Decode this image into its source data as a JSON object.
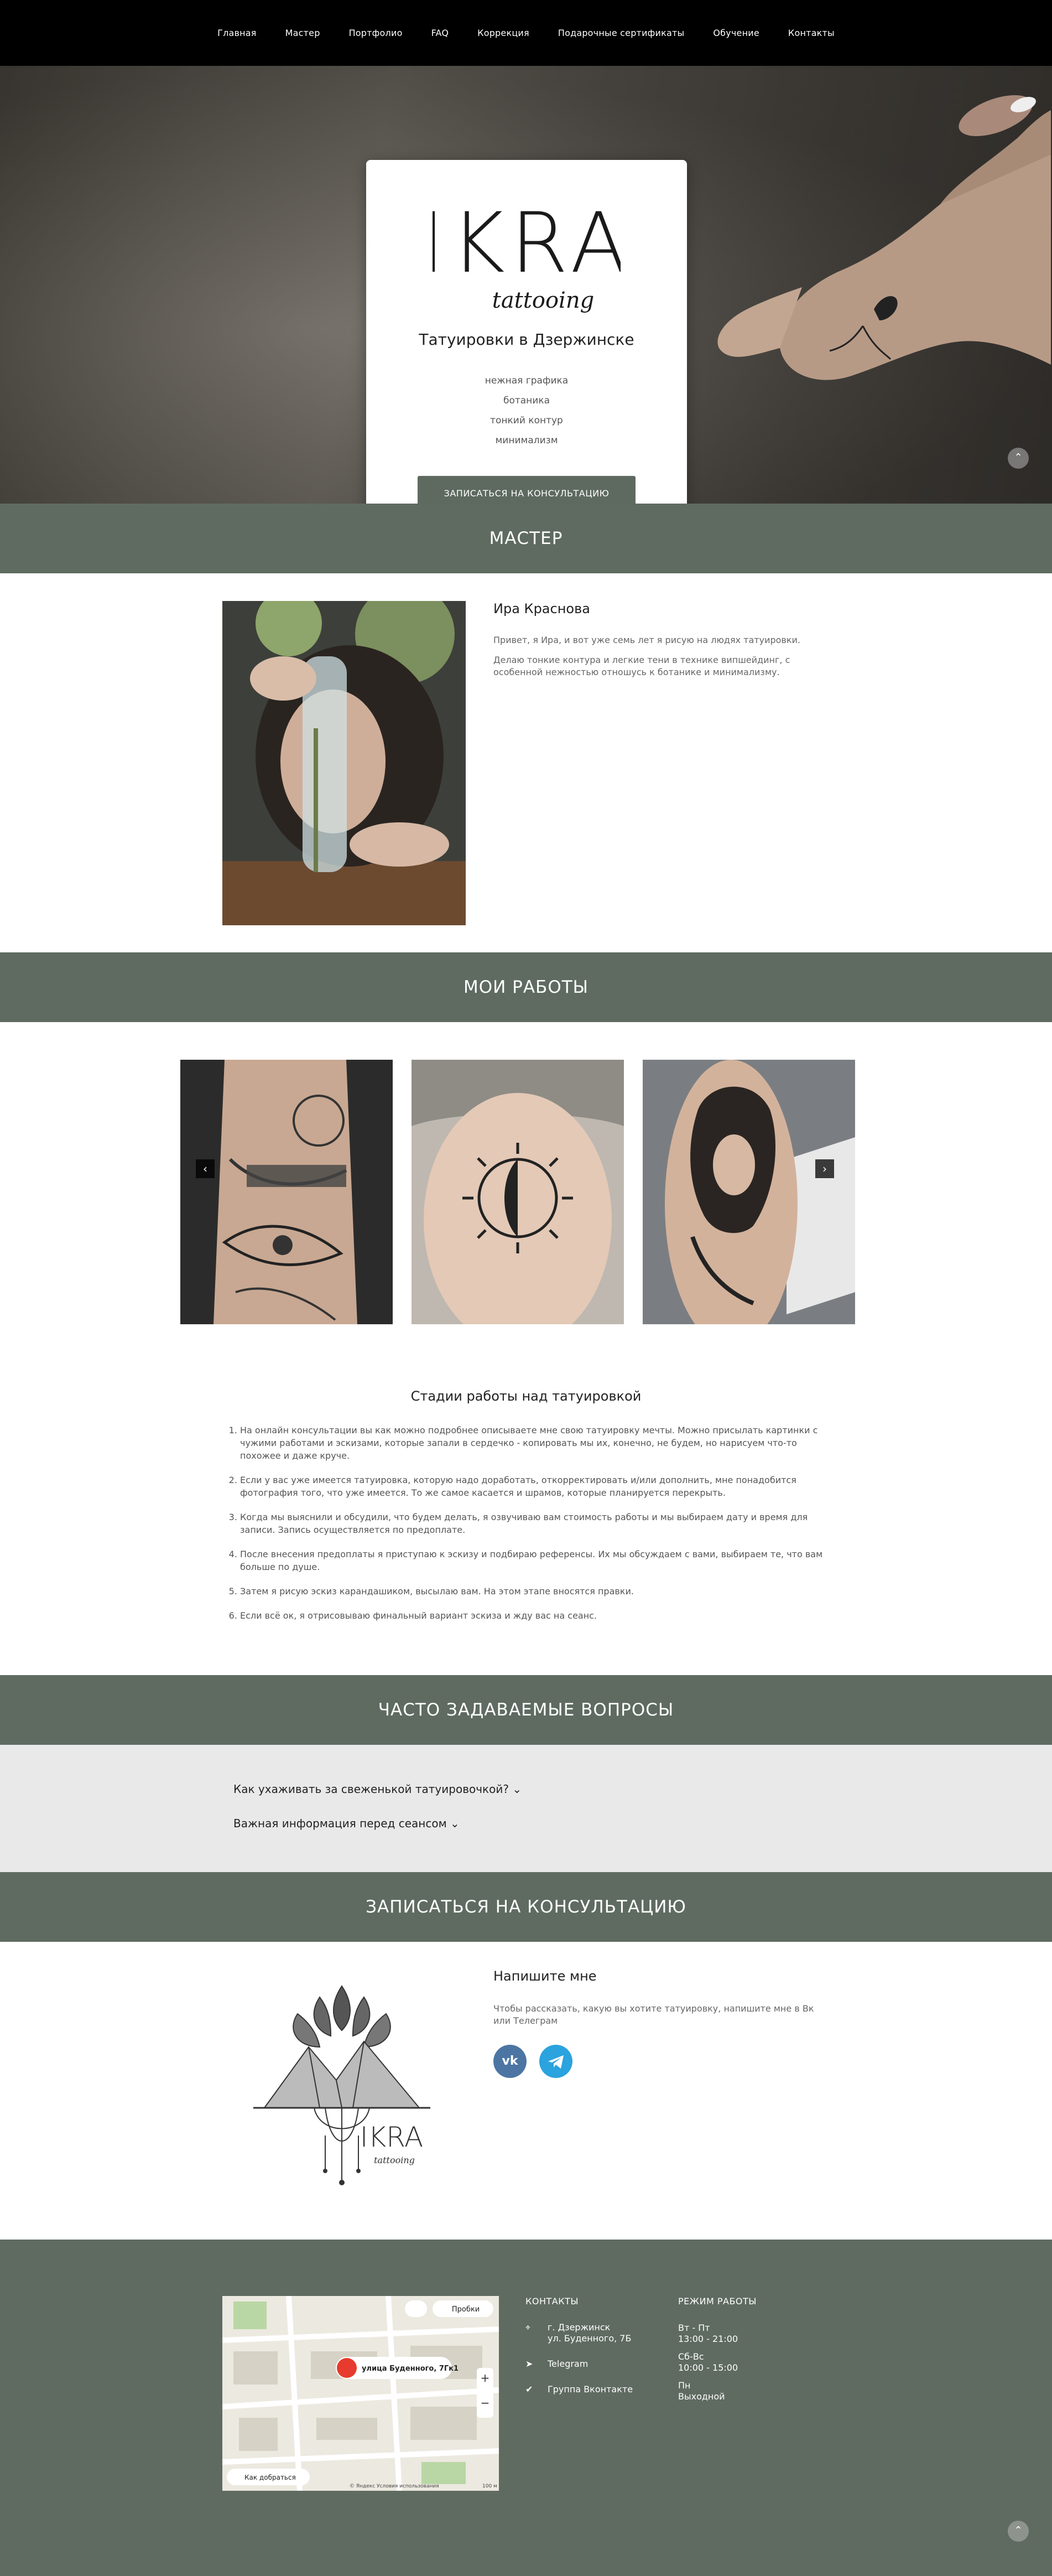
{
  "nav": {
    "items": [
      "Главная",
      "Мастер",
      "Портфолио",
      "FAQ",
      "Коррекция",
      "Подарочные сертификаты",
      "Обучение",
      "Контакты"
    ]
  },
  "hero": {
    "logo_main": "IKRA",
    "logo_sub": "tattooing",
    "title": "Татуировки в Дзержинске",
    "styles": [
      "нежная графика",
      "ботаника",
      "тонкий контур",
      "минимализм"
    ],
    "cta": "ЗАПИСАТЬСЯ НА КОНСУЛЬТАЦИЮ"
  },
  "master": {
    "heading": "МАСТЕР",
    "name": "Ира Краснова",
    "p1": "Привет, я Ира, и вот уже семь лет я рисую на людях татуировки.",
    "p2": "Делаю тонкие контура и легкие тени в технике випшейдинг, с особенной нежностью отношусь к ботанике и минимализму."
  },
  "works": {
    "heading": "МОИ РАБОТЫ",
    "stages_title": "Стадии работы над татуировкой",
    "stages": [
      "На онлайн консультации вы как можно подробнее описываете мне свою татуировку мечты. Можно присылать картинки с чужими работами и эскизами, которые запали в сердечко - копировать мы их, конечно, не будем, но нарисуем что-то похожее и даже круче.",
      "Если у вас уже имеется татуировка, которую надо доработать, откорректировать и/или дополнить, мне понадобится фотография того, что уже имеется. То же самое касается и шрамов, которые планируется перекрыть.",
      "Когда мы выяснили и обсудили, что будем делать, я озвучиваю вам стоимость работы и мы выбираем дату и время для записи. Запись осуществляется по предоплате.",
      "После внесения предоплаты я приступаю к эскизу и подбираю референсы. Их мы обсуждаем с вами, выбираем те, что вам больше по душе.",
      "Затем я рисую эскиз карандашиком, высылаю вам. На этом этапе вносятся правки.",
      "Если всё ок, я отрисовываю финальный вариант эскиза и жду вас на сеанс."
    ]
  },
  "faq": {
    "heading": "ЧАСТО ЗАДАВАЕМЫЕ ВОПРОСЫ",
    "q1": "Как ухаживать за свеженькой татуировочкой?",
    "q2": "Важная информация перед сеансом"
  },
  "consult": {
    "heading": "ЗАПИСАТЬСЯ НА КОНСУЛЬТАЦИЮ",
    "title": "Напишите мне",
    "text": "Чтобы рассказать, какую вы хотите татуировку, напишите мне в Вк или Телеграм",
    "vk": "vk",
    "logo_main": "IKRA",
    "logo_sub": "tattooing"
  },
  "footer": {
    "contacts_title": "КОНТАКТЫ",
    "address_line1": "г. Дзержинск",
    "address_line2": "ул. Буденного, 7Б",
    "telegram": "Telegram",
    "vk_group": "Группа Вконтакте",
    "hours_title": "РЕЖИМ РАБОТЫ",
    "h1_days": "Вт - Пт",
    "h1_time": "13:00 - 21:00",
    "h2_days": "Сб-Вс",
    "h2_time": "10:00 - 15:00",
    "h3_days": "Пн",
    "h3_time": "Выходной",
    "map": {
      "place": "улица Буденного, 7Гк1",
      "traffic": "Пробки",
      "route": "Как добраться",
      "copyright": "© Яндекс  Условия использования",
      "scale": "100 м"
    }
  },
  "colors": {
    "accent": "#5f6b61",
    "nav_bg": "#000000",
    "faq_bg": "#e9e9e9",
    "button": "#5e6a60",
    "vk": "#4c75a3",
    "telegram": "#2aa3de"
  },
  "icons": [
    "location-pin-icon",
    "telegram-icon",
    "vk-icon",
    "chevron-down-icon",
    "arrow-left-icon",
    "arrow-right-icon",
    "arrow-up-icon"
  ]
}
